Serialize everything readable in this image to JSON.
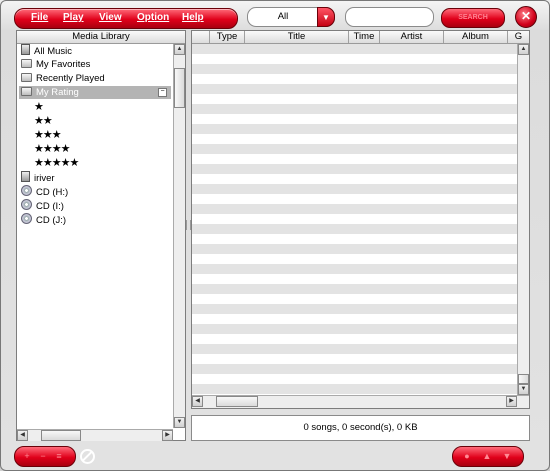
{
  "menu": [
    "File",
    "Play",
    "View",
    "Option",
    "Help"
  ],
  "filter": {
    "value": "All"
  },
  "search": {
    "value": "",
    "button_label": "SEARCH"
  },
  "library": {
    "header": "Media Library",
    "items": [
      {
        "label": "All Music",
        "icon": "music-library-icon"
      },
      {
        "label": "My Favorites",
        "icon": "folder-icon"
      },
      {
        "label": "Recently Played",
        "icon": "folder-icon"
      },
      {
        "label": "My Rating",
        "icon": "folder-icon",
        "selected": true
      }
    ],
    "ratings": [
      "★",
      "★★",
      "★★★",
      "★★★★",
      "★★★★★"
    ],
    "devices": [
      {
        "label": "iriver",
        "icon": "device-icon"
      },
      {
        "label": "CD (H:)",
        "icon": "cd-icon"
      },
      {
        "label": "CD (I:)",
        "icon": "cd-icon"
      },
      {
        "label": "CD (J:)",
        "icon": "cd-icon"
      }
    ]
  },
  "columns": [
    "",
    "Type",
    "Title",
    "Time",
    "Artist",
    "Album",
    "G"
  ],
  "status": "0 songs, 0 second(s), 0 KB",
  "close_label": "✕"
}
